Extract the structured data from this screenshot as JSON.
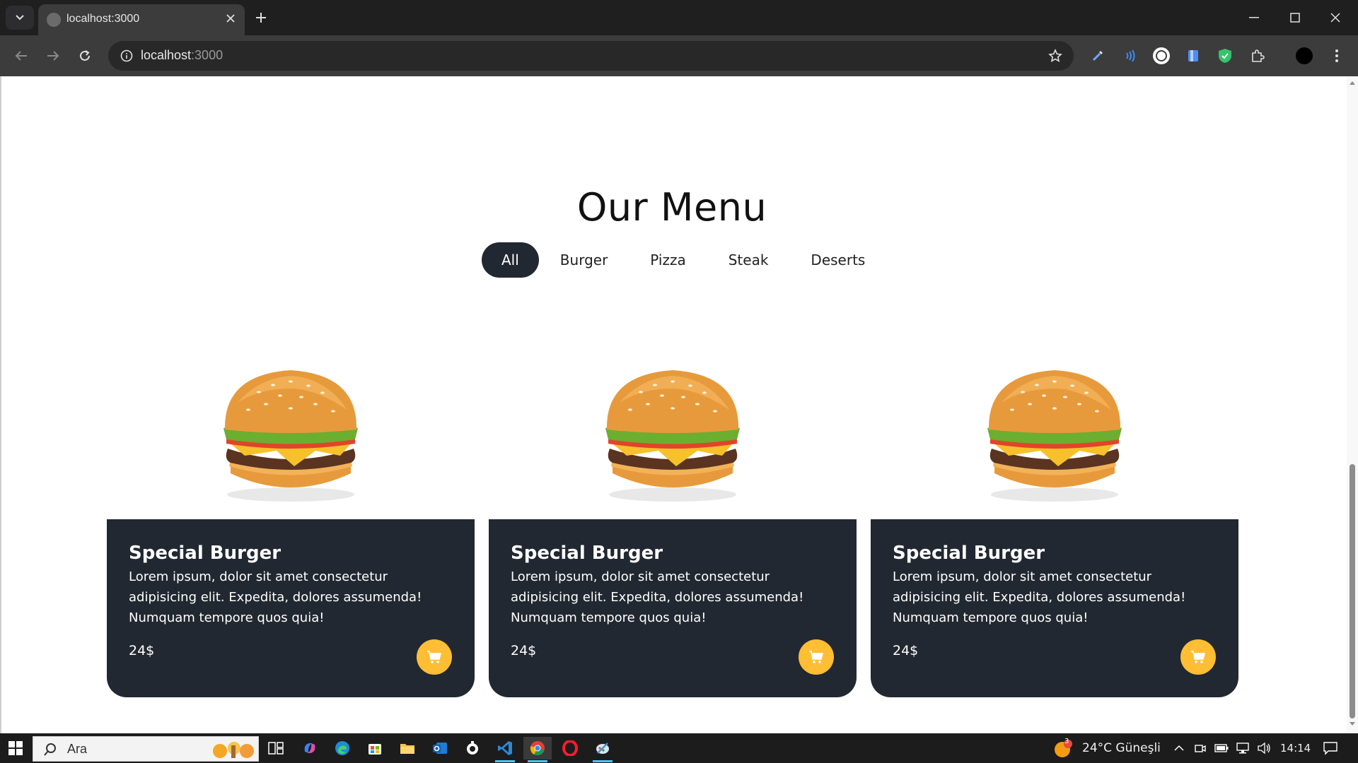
{
  "browser": {
    "tab_title": "localhost:3000",
    "url_host": "localhost",
    "url_port": ":3000"
  },
  "page": {
    "title": "Our Menu",
    "filters": [
      {
        "label": "All",
        "active": true
      },
      {
        "label": "Burger",
        "active": false
      },
      {
        "label": "Pizza",
        "active": false
      },
      {
        "label": "Steak",
        "active": false
      },
      {
        "label": "Deserts",
        "active": false
      }
    ],
    "cards": [
      {
        "name": "Special Burger",
        "description": "Lorem ipsum, dolor sit amet consectetur adipisicing elit. Expedita, dolores assumenda! Numquam tempore quos quia!",
        "price": "24$"
      },
      {
        "name": "Special Burger",
        "description": "Lorem ipsum, dolor sit amet consectetur adipisicing elit. Expedita, dolores assumenda! Numquam tempore quos quia!",
        "price": "24$"
      },
      {
        "name": "Special Burger",
        "description": "Lorem ipsum, dolor sit amet consectetur adipisicing elit. Expedita, dolores assumenda! Numquam tempore quos quia!",
        "price": "24$"
      }
    ],
    "colors": {
      "card_bg": "#222831",
      "accent": "#ffbe33",
      "active_filter": "#222831"
    }
  },
  "taskbar": {
    "search_label": "Ara",
    "weather": "24°C  Güneşli",
    "weather_badge": "3",
    "time": "14:14"
  }
}
